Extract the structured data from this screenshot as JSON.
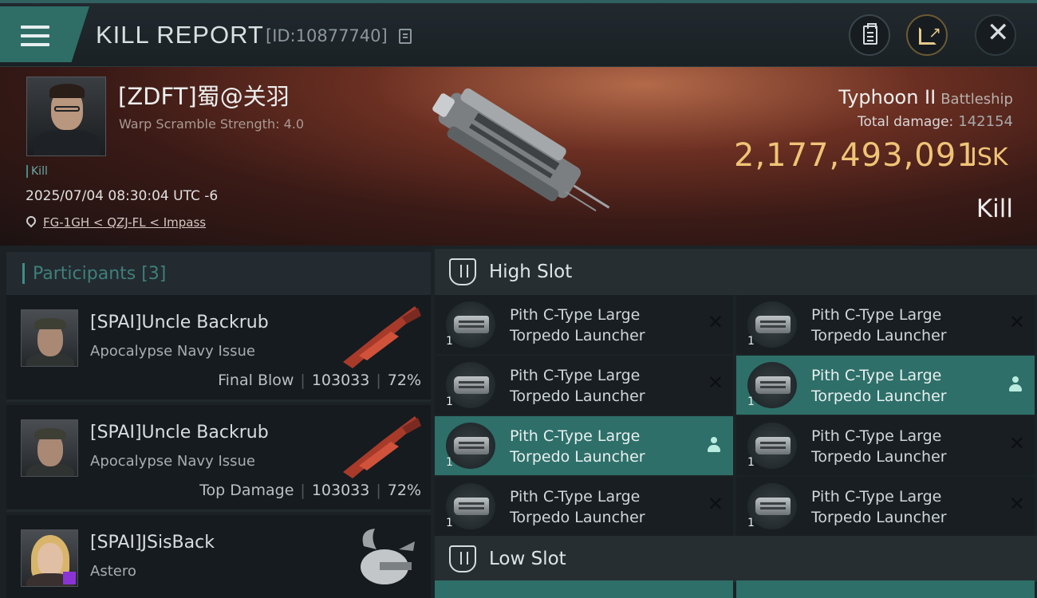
{
  "header": {
    "title": "KILL REPORT",
    "report_id": "[ID:10877740]"
  },
  "victim": {
    "name": "[ZDFT]蜀@关羽",
    "warp_scramble": "Warp Scramble Strength: 4.0",
    "tag": "Kill",
    "datetime": "2025/07/04 08:30:04 UTC -6",
    "location": "FG-1GH < QZJ-FL < Impass",
    "ship_name": "Typhoon II",
    "ship_class": "Battleship",
    "total_damage_label": "Total damage:",
    "total_damage": "142154",
    "isk_value": "2,177,493,091",
    "isk_unit": "ISK",
    "result": "Kill"
  },
  "participants": {
    "header": "Participants [3]",
    "rows": [
      {
        "name": "[SPAI]Uncle Backrub",
        "ship": "Apocalypse Navy Issue",
        "role": "Final Blow",
        "damage": "103033",
        "percent": "72%"
      },
      {
        "name": "[SPAI]Uncle Backrub",
        "ship": "Apocalypse Navy Issue",
        "role": "Top Damage",
        "damage": "103033",
        "percent": "72%"
      },
      {
        "name": "[SPAI]JSisBack",
        "ship": "Astero"
      }
    ]
  },
  "fitting": {
    "high_slot": {
      "title": "High Slot",
      "items": [
        {
          "name": "Pith C-Type Large Torpedo Launcher",
          "qty": "1",
          "status": "destroyed"
        },
        {
          "name": "Pith C-Type Large Torpedo Launcher",
          "qty": "1",
          "status": "destroyed"
        },
        {
          "name": "Pith C-Type Large Torpedo Launcher",
          "qty": "1",
          "status": "destroyed"
        },
        {
          "name": "Pith C-Type Large Torpedo Launcher",
          "qty": "1",
          "status": "dropped"
        },
        {
          "name": "Pith C-Type Large Torpedo Launcher",
          "qty": "1",
          "status": "dropped"
        },
        {
          "name": "Pith C-Type Large Torpedo Launcher",
          "qty": "1",
          "status": "destroyed"
        },
        {
          "name": "Pith C-Type Large Torpedo Launcher",
          "qty": "1",
          "status": "destroyed"
        },
        {
          "name": "Pith C-Type Large Torpedo Launcher",
          "qty": "1",
          "status": "destroyed"
        }
      ]
    },
    "low_slot": {
      "title": "Low Slot"
    }
  },
  "icons": {
    "menu": "hamburger-icon",
    "copy": "copy-icon",
    "clipboard": "clipboard-icon",
    "share": "share-icon",
    "close": "close-icon",
    "location": "map-pin-icon",
    "slot": "shield-icon",
    "destroyed": "x-icon",
    "dropped": "person-icon"
  },
  "colors": {
    "accent": "#3f8d86",
    "isk": "#f0c477",
    "highlight": "#2e6f69"
  }
}
